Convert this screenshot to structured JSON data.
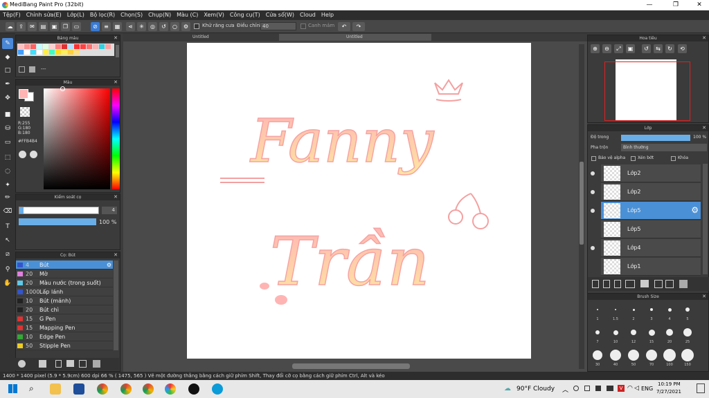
{
  "window": {
    "title": "MediBang Paint Pro (32bit)",
    "minimize": "—",
    "maximize": "❐",
    "close": "✕"
  },
  "menu": [
    "Tệp(F)",
    "Chỉnh sửa(E)",
    "Lớp(L)",
    "Bộ lọc(R)",
    "Chọn(S)",
    "Chụp(N)",
    "Màu (C)",
    "Xem(V)",
    "Công cụ(T)",
    "Cửa sổ(W)",
    "Cloud",
    "Help"
  ],
  "toolbar": {
    "antialias_label": "Khử răng cưa",
    "adjust_label": "Điều chỉnh",
    "adjust_value": "40",
    "smooth_label": "Canh mảm"
  },
  "tabs": [
    "Untitled",
    "Untitled"
  ],
  "palette_panel": {
    "title": "Bảng màu",
    "label": "---"
  },
  "color_panel": {
    "title": "Màu",
    "r": "R:255",
    "g": "G:180",
    "b": "B:180",
    "hex": "#FFB4B4"
  },
  "brush_control": {
    "title": "Kiểm soát cọ",
    "size": "4",
    "opacity": "100 %"
  },
  "brush_panel": {
    "title": "Cọ: Bút",
    "items": [
      {
        "size": "4",
        "name": "Bút",
        "color": "#3355cc"
      },
      {
        "size": "20",
        "name": "Mờ",
        "color": "#e080e0"
      },
      {
        "size": "20",
        "name": "Màu nước (trong suốt)",
        "color": "#5fc8e8"
      },
      {
        "size": "1000",
        "name": "Lấp lánh",
        "color": "#3355cc"
      },
      {
        "size": "10",
        "name": "Bút (mảnh)",
        "color": "#222222"
      },
      {
        "size": "20",
        "name": "Bút chì",
        "color": "#222222"
      },
      {
        "size": "15",
        "name": "G Pen",
        "color": "#dd3333"
      },
      {
        "size": "15",
        "name": "Mapping Pen",
        "color": "#dd3333"
      },
      {
        "size": "10",
        "name": "Edge Pen",
        "color": "#33aa33"
      },
      {
        "size": "50",
        "name": "Stipple Pen",
        "color": "#eecc22"
      }
    ]
  },
  "navigator": {
    "title": "Hoa tiêu"
  },
  "layer_panel": {
    "title": "Lớp",
    "opacity_label": "Độ trong",
    "opacity_value": "100 %",
    "blend_label": "Pha trộn",
    "blend_value": "Bình thường",
    "protect_alpha": "Bảo vệ alpha",
    "clipping": "Xén bớt",
    "lock": "Khóa",
    "layers": [
      {
        "name": "Lớp2",
        "selected": false
      },
      {
        "name": "Lớp2",
        "selected": false
      },
      {
        "name": "Lớp5",
        "selected": true
      },
      {
        "name": "Lớp5",
        "selected": false
      },
      {
        "name": "Lớp4",
        "selected": false
      },
      {
        "name": "Lớp1",
        "selected": false
      }
    ]
  },
  "brush_size_panel": {
    "title": "Brush Size",
    "sizes": [
      "1",
      "1.5",
      "2",
      "3",
      "4",
      "5",
      "7",
      "10",
      "12",
      "15",
      "20",
      "25",
      "30",
      "40",
      "50",
      "70",
      "100",
      "150"
    ]
  },
  "canvas_art": {
    "line1": "Fanny",
    "line2": "Trần"
  },
  "status": {
    "text": "1400 * 1400 pixel   (5.9 * 5.9cm)   600 dpi   66 %   ( 1475, 565 )   Vẽ một đường thẳng bằng cách giữ phím Shift, Thay đổi cỡ cọ bằng cách giữ phím Ctrl, Alt và kéo"
  },
  "taskbar": {
    "weather": "90°F Cloudy",
    "lang": "ENG",
    "time": "10:19 PM",
    "date": "7/27/2021"
  }
}
